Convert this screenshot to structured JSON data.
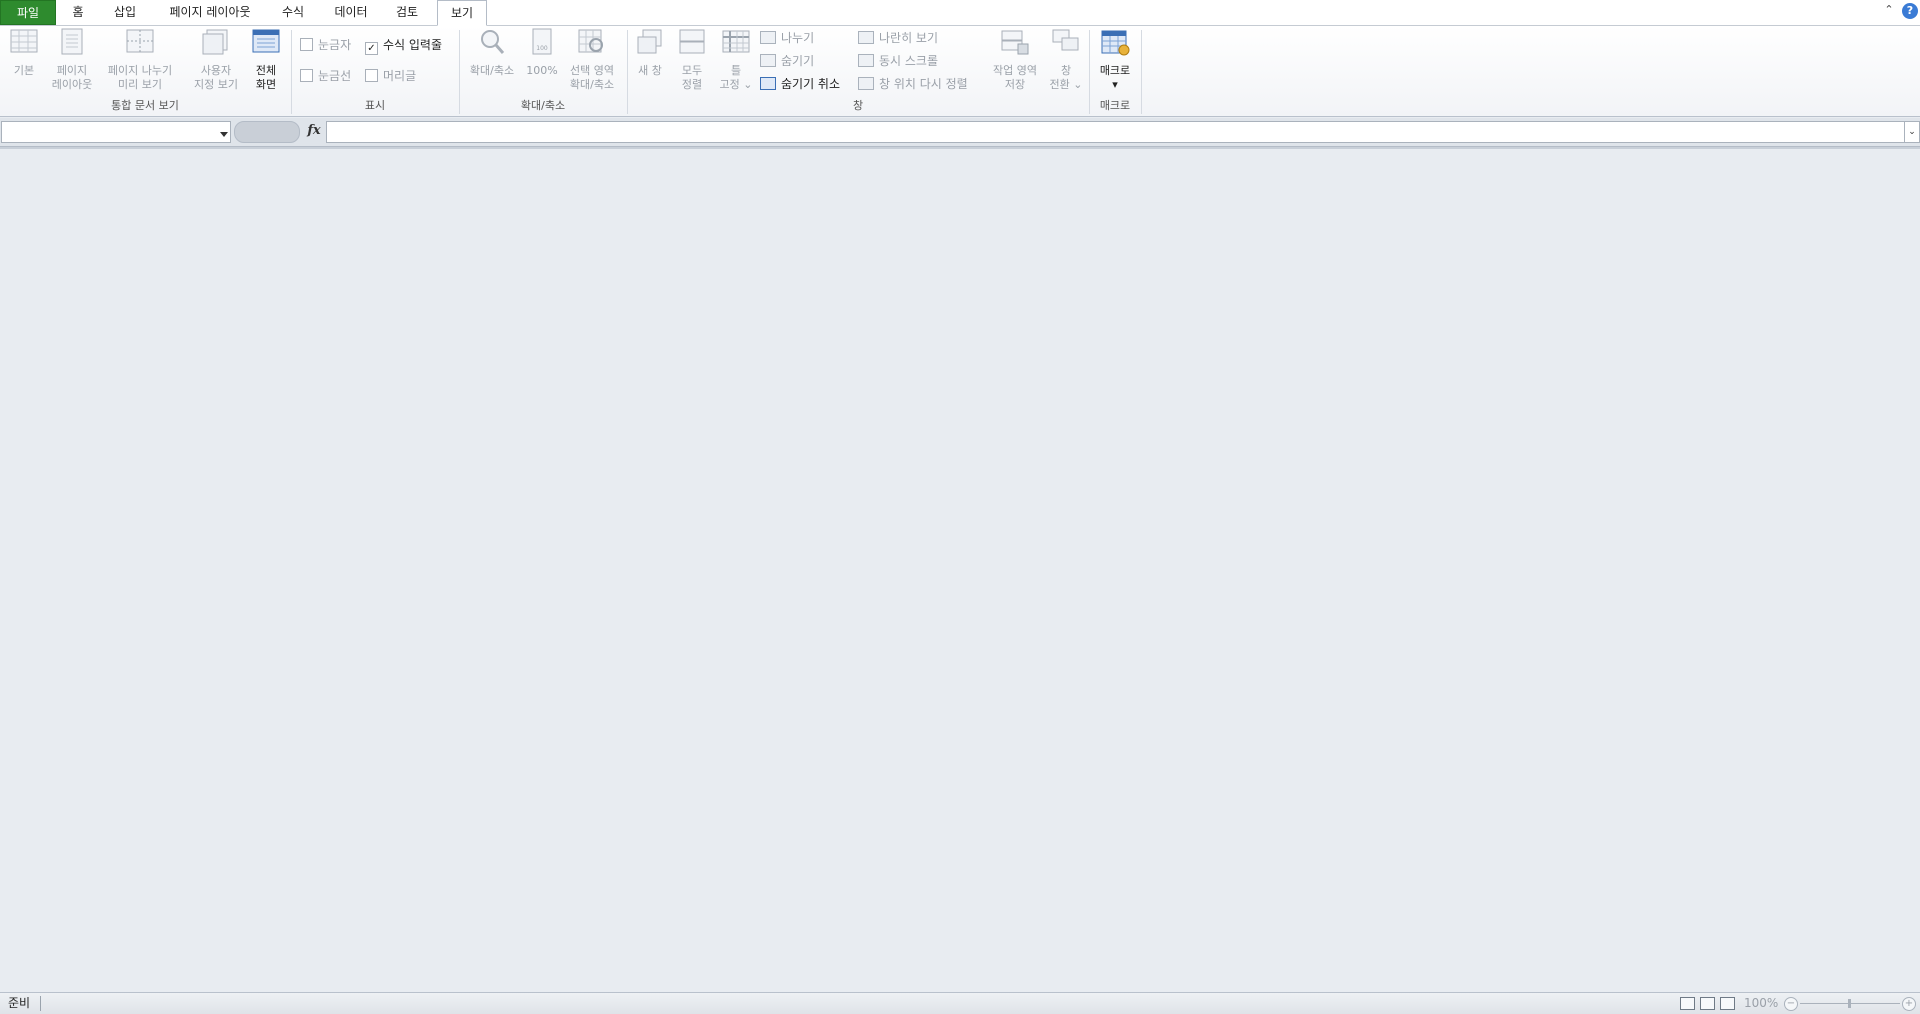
{
  "tabs": [
    {
      "label": "파일"
    },
    {
      "label": "홈"
    },
    {
      "label": "삽입"
    },
    {
      "label": "페이지 레이아웃"
    },
    {
      "label": "수식"
    },
    {
      "label": "데이터"
    },
    {
      "label": "검토"
    },
    {
      "label": "보기"
    }
  ],
  "groups": {
    "workbook_views": {
      "label": "통합 문서 보기",
      "normal_line1": "기본",
      "page_layout_line1": "페이지",
      "page_layout_line2": "레이아웃",
      "page_break_line1": "페이지 나누기",
      "page_break_line2": "미리 보기",
      "custom_line1": "사용자",
      "custom_line2": "지정 보기",
      "full_line1": "전체",
      "full_line2": "화면"
    },
    "show": {
      "label": "표시",
      "ruler": "눈금자",
      "formula_bar": "수식 입력줄",
      "formula_bar_check": "✓",
      "gridlines": "눈금선",
      "headings": "머리글"
    },
    "zoom": {
      "label": "확대/축소",
      "zoom_line1": "확대/축소",
      "hundred_line1": "100%",
      "selection_line1": "선택 영역",
      "selection_line2": "확대/축소"
    },
    "window": {
      "label": "창",
      "new_line1": "새 창",
      "arrange_line1": "모두",
      "arrange_line2": "정렬",
      "freeze_line1": "틀",
      "freeze_line2": "고정",
      "split": "나누기",
      "hide": "숨기기",
      "unhide": "숨기기 취소",
      "side_by_side": "나란히 보기",
      "sync_scroll": "동시 스크롤",
      "reset_position": "창 위치 다시 정렬",
      "save_ws_line1": "작업 영역",
      "save_ws_line2": "저장",
      "switch_line1": "창",
      "switch_line2": "전환"
    },
    "macros": {
      "label": "매크로",
      "macro_line1": "매크로"
    }
  },
  "status": {
    "ready": "준비",
    "zoom": "100%",
    "minus": "−",
    "plus": "+"
  },
  "formula": {
    "fx": "fx"
  }
}
